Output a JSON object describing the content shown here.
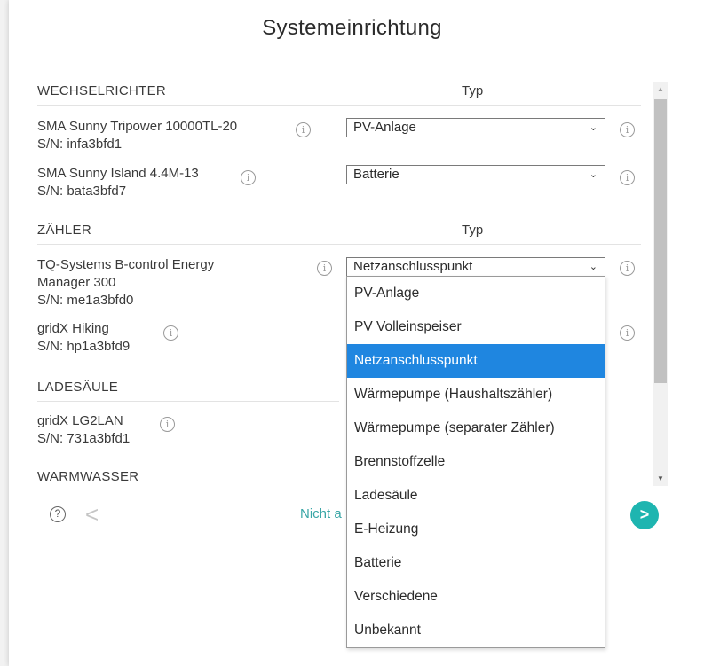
{
  "title": "Systemeinrichtung",
  "sections": {
    "wechselrichter": {
      "label": "WECHSELRICHTER",
      "typ": "Typ",
      "devices": [
        {
          "name": "SMA Sunny Tripower 10000TL-20",
          "serial": "S/N: infa3bfd1",
          "type": "PV-Anlage"
        },
        {
          "name": "SMA Sunny Island 4.4M-13",
          "serial": "S/N: bata3bfd7",
          "type": "Batterie"
        }
      ]
    },
    "zaehler": {
      "label": "ZÄHLER",
      "typ": "Typ",
      "devices": [
        {
          "name": "TQ-Systems B-control Energy Manager 300",
          "serial": "S/N: me1a3bfd0",
          "type": "Netzanschlusspunkt"
        },
        {
          "name": "gridX Hiking",
          "serial": "S/N: hp1a3bfd9"
        }
      ]
    },
    "ladesaeule": {
      "label": "LADESÄULE",
      "devices": [
        {
          "name": "gridX LG2LAN",
          "serial": "S/N: 731a3bfd1"
        }
      ]
    },
    "warmwasser": {
      "label": "WARMWASSER"
    }
  },
  "footer": {
    "help": "?",
    "prev": "<",
    "skip": "Nicht a",
    "next": ">"
  },
  "dropdown": {
    "options": [
      "PV-Anlage",
      "PV Volleinspeiser",
      "Netzanschlusspunkt",
      "Wärmepumpe (Haushaltszähler)",
      "Wärmepumpe (separater Zähler)",
      "Brennstoffzelle",
      "Ladesäule",
      "E-Heizung",
      "Batterie",
      "Verschiedene",
      "Unbekannt"
    ],
    "selected": "Netzanschlusspunkt"
  },
  "info_glyph": "i",
  "chevron_glyph": "⌄",
  "colors": {
    "accent_teal": "#1eb5b0",
    "selection_blue": "#1f86e0"
  }
}
